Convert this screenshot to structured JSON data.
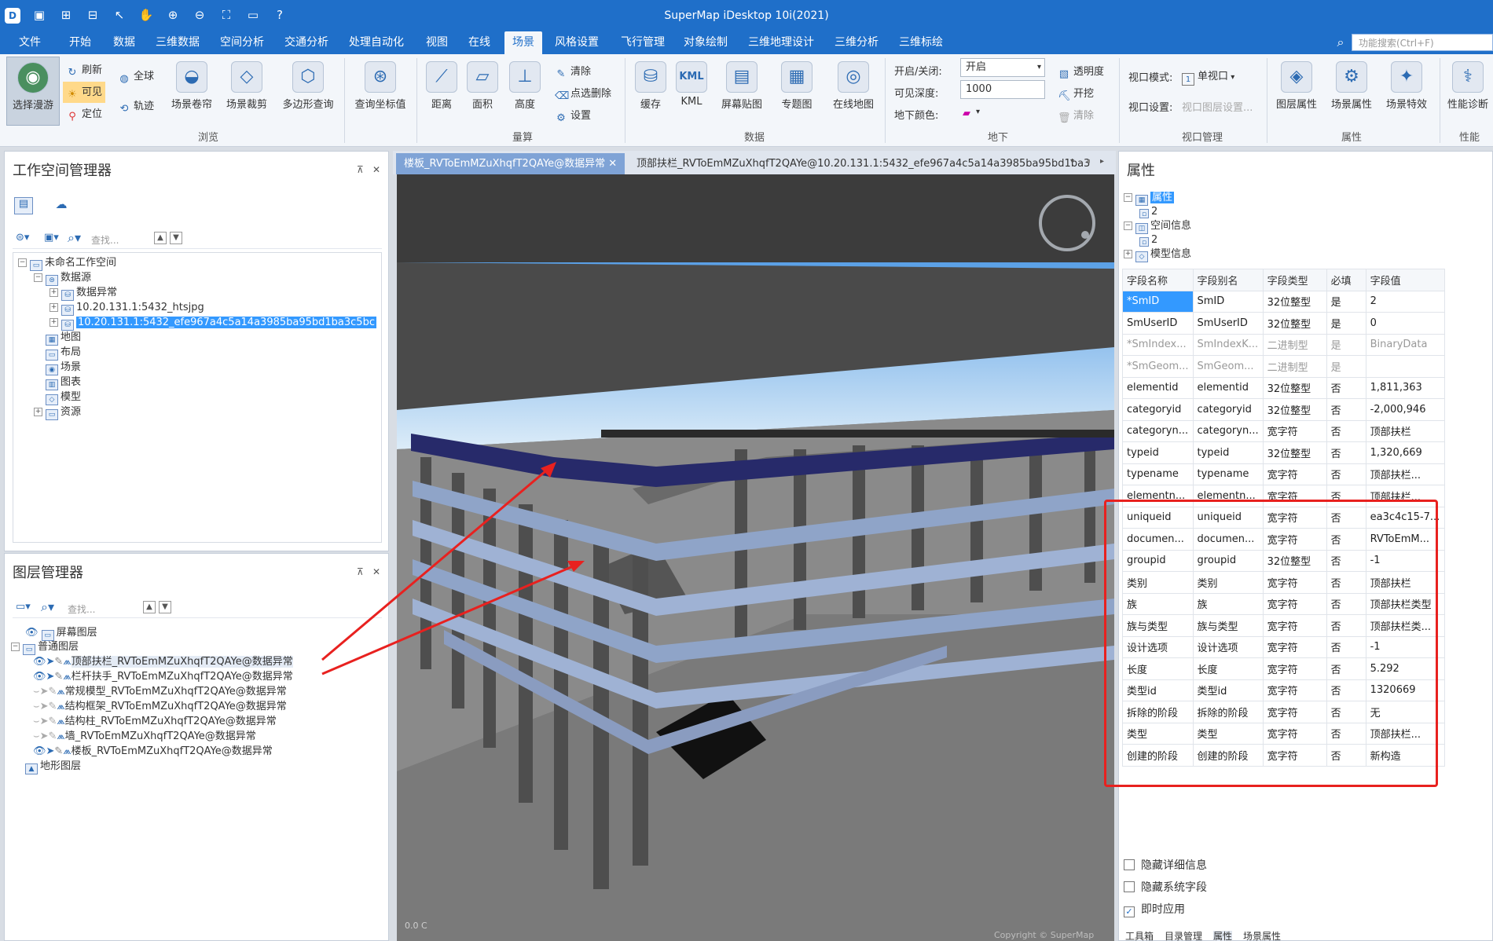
{
  "app": {
    "title": "SuperMap iDesktop 10i(2021)"
  },
  "search": {
    "placeholder": "功能搜索(Ctrl+F)"
  },
  "menu": [
    "文件",
    "开始",
    "数据",
    "三维数据",
    "空间分析",
    "交通分析",
    "处理自动化",
    "视图",
    "在线",
    "场景",
    "风格设置",
    "飞行管理",
    "对象绘制",
    "三维地理设计",
    "三维分析",
    "三维标绘"
  ],
  "menu_active": "场景",
  "ribbon": {
    "browse": {
      "group": "浏览",
      "select_roam": "选择漫游",
      "refresh": "刷新",
      "visible": "可见",
      "locate": "定位",
      "globe": "全球",
      "track": "轨迹",
      "scene_curtain": "场景卷帘",
      "scene_clip": "场景裁剪",
      "polygon_query": "多边形查询",
      "query_coord": "查询坐标值"
    },
    "measure": {
      "group": "量算",
      "distance": "距离",
      "area": "面积",
      "height": "高度",
      "clear": "清除",
      "point_delete": "点选删除",
      "settings": "设置"
    },
    "data": {
      "group": "数据",
      "cache": "缓存",
      "kml": "KML",
      "screen_map": "屏幕贴图",
      "thematic": "专题图",
      "online_map": "在线地图"
    },
    "underground": {
      "group": "地下",
      "on_off_label": "开启/关闭:",
      "on_off_value": "开启",
      "depth_label": "可见深度:",
      "depth_value": "1000",
      "color_label": "地下颜色:",
      "transparency": "透明度",
      "excavate": "开挖",
      "clear": "清除"
    },
    "viewport": {
      "group": "视口管理",
      "mode_label": "视口模式:",
      "mode_value": "单视口",
      "settings_label": "视口设置:",
      "settings_value": "视口图层设置..."
    },
    "properties": {
      "group": "属性",
      "layer_prop": "图层属性",
      "scene_prop": "场景属性",
      "scene_effect": "场景特效"
    },
    "performance": {
      "group": "性能",
      "diagnose": "性能诊断"
    }
  },
  "workspace": {
    "title": "工作空间管理器",
    "search_placeholder": "查找...",
    "tree": [
      "未命名工作空间",
      "数据源",
      "数据异常",
      "10.20.131.1:5432_htsjpg",
      "10.20.131.1:5432_efe967a4c5a14a3985ba95bd1ba3c5bc",
      "地图",
      "布局",
      "场景",
      "图表",
      "模型",
      "资源"
    ]
  },
  "layers": {
    "title": "图层管理器",
    "search_placeholder": "查找...",
    "items": [
      "屏幕图层",
      "普通图层",
      "顶部扶栏_RVToEmMZuXhqfT2QAYe@数据异常",
      "栏杆扶手_RVToEmMZuXhqfT2QAYe@数据异常",
      "常规模型_RVToEmMZuXhqfT2QAYe@数据异常",
      "结构框架_RVToEmMZuXhqfT2QAYe@数据异常",
      "结构柱_RVToEmMZuXhqfT2QAYe@数据异常",
      "墙_RVToEmMZuXhqfT2QAYe@数据异常",
      "楼板_RVToEmMZuXhqfT2QAYe@数据异常",
      "地形图层"
    ]
  },
  "doc_tabs": [
    "楼板_RVToEmMZuXhqfT2QAYe@数据异常",
    "顶部扶栏_RVToEmMZuXhqfT2QAYe@10.20.131.1:5432_efe967a4c5a14a3985ba95bd1ba3"
  ],
  "scene": {
    "watermark": "Copyright © SuperMap",
    "scale_hint": "0.0 C"
  },
  "properties": {
    "title": "属性",
    "tree": [
      "属性",
      "2",
      "空间信息",
      "2",
      "模型信息"
    ],
    "headers": [
      "字段名称",
      "字段别名",
      "字段类型",
      "必填",
      "字段值"
    ],
    "rows": [
      [
        "*SmID",
        "SmID",
        "32位整型",
        "是",
        "2"
      ],
      [
        "SmUserID",
        "SmUserID",
        "32位整型",
        "是",
        "0"
      ],
      [
        "*SmIndex...",
        "SmIndexK...",
        "二进制型",
        "是",
        "BinaryData"
      ],
      [
        "*SmGeom...",
        "SmGeom...",
        "二进制型",
        "是",
        ""
      ],
      [
        "elementid",
        "elementid",
        "32位整型",
        "否",
        "1,811,363"
      ],
      [
        "categoryid",
        "categoryid",
        "32位整型",
        "否",
        "-2,000,946"
      ],
      [
        "categoryn...",
        "categoryn...",
        "宽字符",
        "否",
        "顶部扶栏"
      ],
      [
        "typeid",
        "typeid",
        "32位整型",
        "否",
        "1,320,669"
      ],
      [
        "typename",
        "typename",
        "宽字符",
        "否",
        "顶部扶栏..."
      ],
      [
        "elementn...",
        "elementn...",
        "宽字符",
        "否",
        "顶部扶栏..."
      ],
      [
        "uniqueid",
        "uniqueid",
        "宽字符",
        "否",
        "ea3c4c15-7..."
      ],
      [
        "documen...",
        "documen...",
        "宽字符",
        "否",
        "RVToEmM..."
      ],
      [
        "groupid",
        "groupid",
        "32位整型",
        "否",
        "-1"
      ],
      [
        "类别",
        "类别",
        "宽字符",
        "否",
        "顶部扶栏"
      ],
      [
        "族",
        "族",
        "宽字符",
        "否",
        "顶部扶栏类型"
      ],
      [
        "族与类型",
        "族与类型",
        "宽字符",
        "否",
        "顶部扶栏类..."
      ],
      [
        "设计选项",
        "设计选项",
        "宽字符",
        "否",
        "-1"
      ],
      [
        "长度",
        "长度",
        "宽字符",
        "否",
        "5.292"
      ],
      [
        "类型id",
        "类型id",
        "宽字符",
        "否",
        "1320669"
      ],
      [
        "拆除的阶段",
        "拆除的阶段",
        "宽字符",
        "否",
        "无"
      ],
      [
        "类型",
        "类型",
        "宽字符",
        "否",
        "顶部扶栏..."
      ],
      [
        "创建的阶段",
        "创建的阶段",
        "宽字符",
        "否",
        "新构造"
      ]
    ],
    "options": [
      {
        "label": "隐藏详细信息",
        "checked": false
      },
      {
        "label": "隐藏系统字段",
        "checked": false
      },
      {
        "label": "即时应用",
        "checked": true
      }
    ],
    "bottom_tabs": [
      "工具箱",
      "目录管理",
      "属性",
      "场景属性"
    ]
  }
}
